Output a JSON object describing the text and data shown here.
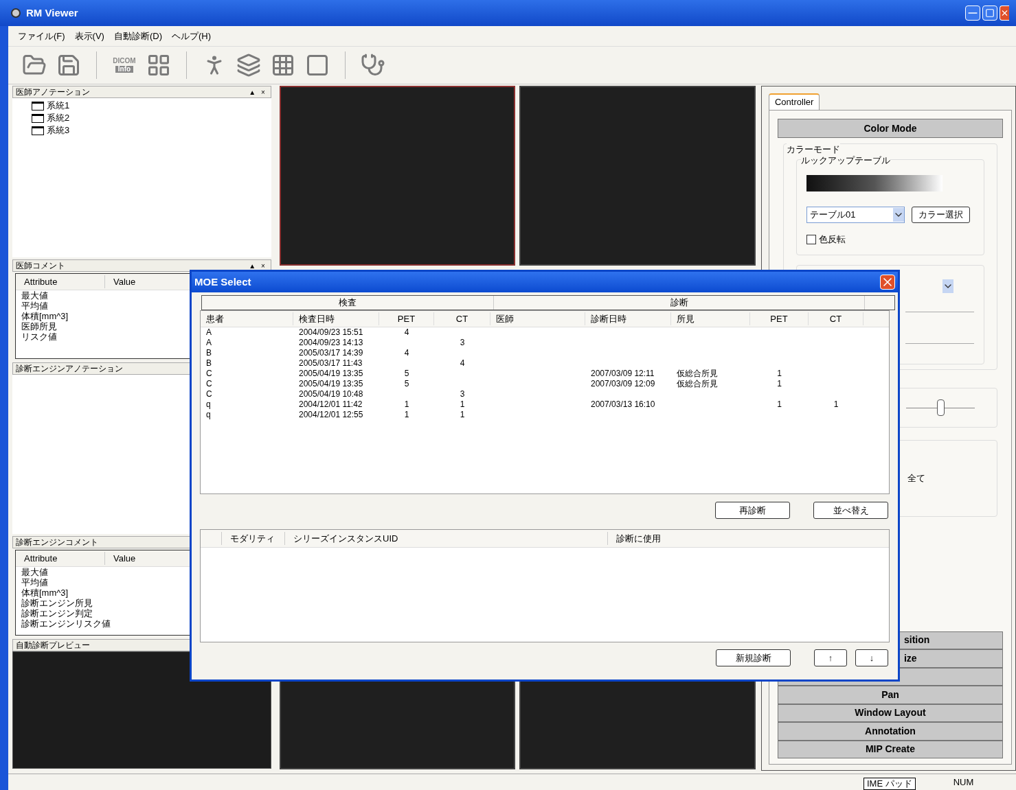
{
  "window": {
    "title": "RM Viewer"
  },
  "menu": [
    "ファイル(F)",
    "表示(V)",
    "自動診断(D)",
    "ヘルプ(H)"
  ],
  "toolbar": [
    {
      "kind": "open"
    },
    {
      "kind": "save"
    },
    {
      "kind": "separator"
    },
    {
      "kind": "dicom",
      "label": "DICOM",
      "sublabel": "Info"
    },
    {
      "kind": "layout"
    },
    {
      "kind": "separator"
    },
    {
      "kind": "body"
    },
    {
      "kind": "stack"
    },
    {
      "kind": "grid"
    },
    {
      "kind": "slice"
    },
    {
      "kind": "separator"
    },
    {
      "kind": "stethoscope"
    }
  ],
  "left_panels": [
    {
      "kind": "tree",
      "title": "医師アノテーション",
      "controls": [
        "▲",
        "×"
      ],
      "items": [
        "系統1",
        "系統2",
        "系統3"
      ]
    },
    {
      "kind": "attributes",
      "title": "医師コメント",
      "controls": [
        "▲",
        "×"
      ],
      "columns": [
        "Attribute",
        "Value"
      ],
      "items": [
        "最大値",
        "平均値",
        "体積[mm^3]",
        "医師所見",
        "リスク値"
      ]
    },
    {
      "kind": "blank",
      "title": "診断エンジンアノテーション"
    },
    {
      "kind": "attributes",
      "title": "診断エンジンコメント",
      "columns": [
        "Attribute",
        "Value"
      ],
      "items": [
        "最大値",
        "平均値",
        "体積[mm^3]",
        "診断エンジン所見",
        "診断エンジン判定",
        "診断エンジンリスク値"
      ]
    },
    {
      "kind": "preview",
      "title": "自動診断プレビュー"
    }
  ],
  "viewports": [
    {
      "selected": true
    },
    {
      "selected": false
    },
    {
      "selected": false
    },
    {
      "selected": false
    }
  ],
  "controller": {
    "tabs": [
      {
        "label": "Controller",
        "selected": true
      }
    ],
    "header": "Color Mode",
    "group": "カラーモード",
    "lut_group": "ルックアップテーブル",
    "table_select": "テーブル01",
    "color_button": "カラー選択",
    "invert": {
      "label": "色反転",
      "checked": false
    },
    "slider": {
      "level": 0.5
    },
    "partial_label": "全て",
    "sections": [
      {
        "kind": "cut",
        "label": "sition"
      },
      {
        "kind": "cut",
        "label": "ize"
      },
      {
        "kind": "covered"
      },
      {
        "kind": "full",
        "label": "Pan"
      },
      {
        "kind": "full",
        "label": "Window Layout"
      },
      {
        "kind": "full",
        "label": "Annotation"
      },
      {
        "kind": "full",
        "label": "MIP Create"
      }
    ]
  },
  "dialog": {
    "title": "MOE Select",
    "groups": [
      "検査",
      "診断"
    ],
    "columns": [
      "患者",
      "検査日時",
      "PET",
      "CT",
      "医師",
      "診断日時",
      "所見",
      "PET",
      "CT"
    ],
    "rows": [
      {
        "patient": "A",
        "exam_datetime": "2004/09/23 15:51",
        "exam_pet": "4"
      },
      {
        "patient": "A",
        "exam_datetime": "2004/09/23 14:13",
        "exam_ct": "3"
      },
      {
        "patient": "B",
        "exam_datetime": "2005/03/17 14:39",
        "exam_pet": "4"
      },
      {
        "patient": "B",
        "exam_datetime": "2005/03/17 11:43",
        "exam_ct": "4"
      },
      {
        "patient": "C",
        "exam_datetime": "2005/04/19 13:35",
        "exam_pet": "5",
        "diag_datetime": "2007/03/09 12:11",
        "finding": "仮総合所見",
        "diag_pet": "1"
      },
      {
        "patient": "C",
        "exam_datetime": "2005/04/19 13:35",
        "exam_pet": "5",
        "diag_datetime": "2007/03/09 12:09",
        "finding": "仮総合所見",
        "diag_pet": "1"
      },
      {
        "patient": "C",
        "exam_datetime": "2005/04/19 10:48",
        "exam_ct": "3"
      },
      {
        "patient": "q",
        "exam_datetime": "2004/12/01 11:42",
        "exam_pet": "1",
        "exam_ct": "1",
        "diag_datetime": "2007/03/13 16:10",
        "diag_pet": "1",
        "diag_ct": "1"
      },
      {
        "patient": "q",
        "exam_datetime": "2004/12/01 12:55",
        "exam_pet": "1",
        "exam_ct": "1"
      }
    ],
    "buttons": [
      "再診断",
      "並べ替え"
    ],
    "series_columns": [
      "モダリティ",
      "シリーズインスタンスUID",
      "診断に使用"
    ],
    "bottom_buttons": [
      "新規診断",
      "↑",
      "↓"
    ]
  },
  "status_bar": {
    "ime": "IME パッド",
    "num": "NUM"
  }
}
